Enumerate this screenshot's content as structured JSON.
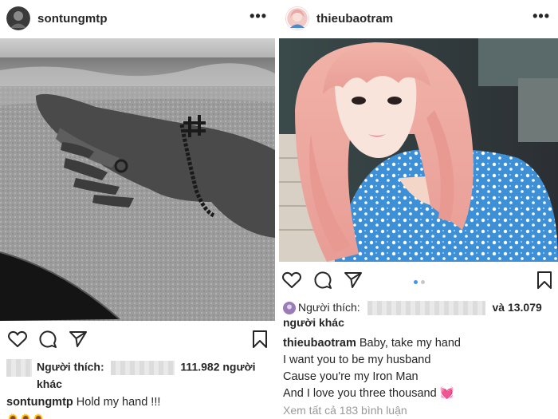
{
  "left_post": {
    "username": "sontungmtp",
    "more_icon": "•••",
    "likes": {
      "prefix": "Người thích:",
      "count": "111.982 người",
      "suffix": "khác"
    },
    "caption": {
      "username": "sontungmtp",
      "text": "Hold my hand !!!",
      "emoji": "🌻🌻🌻"
    }
  },
  "right_post": {
    "username": "thieubaotram",
    "more_icon": "•••",
    "carousel": {
      "count": 2,
      "active": 1
    },
    "likes": {
      "prefix": "Người thích:",
      "count": "và 13.079",
      "suffix": "người khác"
    },
    "caption": {
      "username": "thieubaotram",
      "lines": [
        "Baby, take my hand",
        "I want you to be my husband",
        "Cause you're my Iron Man",
        "And I love you three thousand"
      ],
      "emoji": "💓"
    },
    "view_comments": "Xem tất cả 183 bình luận"
  },
  "colors": {
    "text": "#262626",
    "muted": "#999999",
    "carousel_active": "#3897f0",
    "heart_emoji": "#e84393"
  },
  "icons": [
    "heart-icon",
    "comment-icon",
    "share-icon",
    "bookmark-icon",
    "more-icon"
  ]
}
